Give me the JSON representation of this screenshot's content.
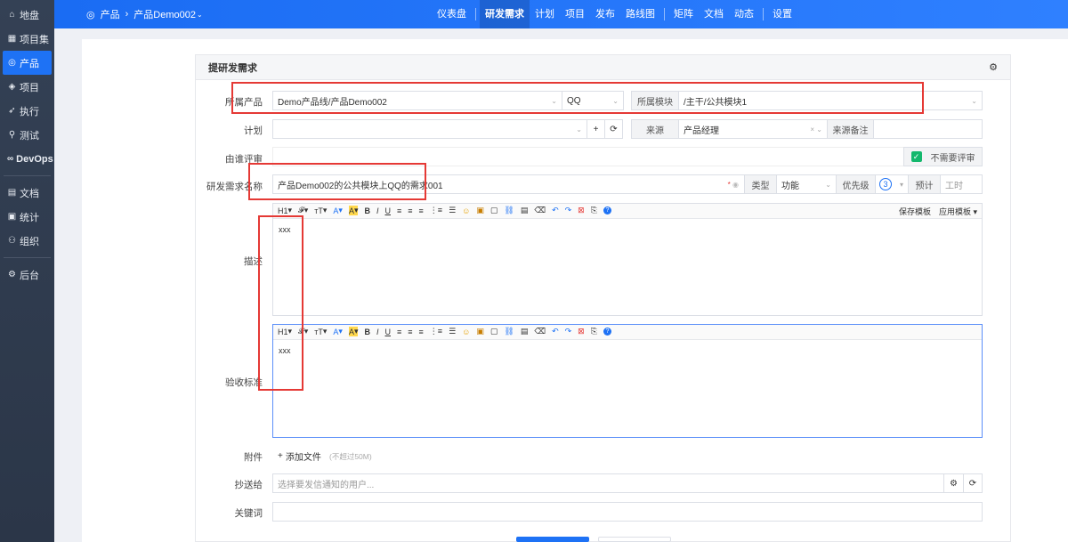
{
  "sidebar": {
    "items": [
      {
        "label": "地盘",
        "icon": "home-icon",
        "glyph": "⌂"
      },
      {
        "label": "项目集",
        "icon": "grid-icon",
        "glyph": "▦"
      },
      {
        "label": "产品",
        "icon": "location-pin-icon",
        "glyph": "◎"
      },
      {
        "label": "项目",
        "icon": "bell-icon",
        "glyph": "◈"
      },
      {
        "label": "执行",
        "icon": "run-icon",
        "glyph": "➶"
      },
      {
        "label": "测试",
        "icon": "magnifier-icon",
        "glyph": "⚲"
      },
      {
        "label": "DevOps",
        "icon": "infinity-icon",
        "glyph": "∞"
      },
      {
        "label": "文档",
        "icon": "document-icon",
        "glyph": "▤"
      },
      {
        "label": "统计",
        "icon": "chart-icon",
        "glyph": "▣"
      },
      {
        "label": "组织",
        "icon": "people-icon",
        "glyph": "⚇"
      },
      {
        "label": "后台",
        "icon": "gear-icon",
        "glyph": "⚙"
      }
    ]
  },
  "breadcrumb": {
    "section": "产品",
    "current": "产品Demo002"
  },
  "topnav": {
    "items": [
      "仪表盘",
      "研发需求",
      "计划",
      "项目",
      "发布",
      "路线图",
      "矩阵",
      "文档",
      "动态",
      "设置"
    ]
  },
  "form": {
    "title": "提研发需求",
    "product_label": "所属产品",
    "product_value": "Demo产品线/产品Demo002",
    "branch_value": "QQ",
    "module_label": "所属模块",
    "module_value": "/主干/公共模块1",
    "plan_label": "计划",
    "source_label": "来源",
    "source_value": "产品经理",
    "source_note_label": "来源备注",
    "reviewer_label": "由谁评审",
    "no_review_label": "不需要评审",
    "name_label": "研发需求名称",
    "name_value": "产品Demo002的公共模块上QQ的需求001",
    "type_label": "类型",
    "type_value": "功能",
    "priority_label": "优先级",
    "priority_value": "3",
    "estimate_label": "预计",
    "estimate_placeholder": "工时",
    "desc_label": "描述",
    "desc_value": "xxx",
    "accept_label": "验收标准",
    "accept_value": "xxx",
    "save_template": "保存模板",
    "apply_template": "应用模板",
    "attach_label": "附件",
    "add_file": "添加文件",
    "file_limit": "(不超过50M)",
    "mailto_label": "抄送给",
    "mailto_placeholder": "选择要发信通知的用户...",
    "keywords_label": "关键词"
  },
  "toolbar_items": [
    "H1",
    "𝓕",
    "тT",
    "A",
    "A",
    "B",
    "I",
    "U",
    "≡",
    "≡",
    "≡",
    "⋮≡",
    "☰",
    "☺",
    "▣",
    "▢",
    "⛓",
    "▤",
    "⌫",
    "↶",
    "↷",
    "⊠",
    "⎘",
    "?"
  ]
}
